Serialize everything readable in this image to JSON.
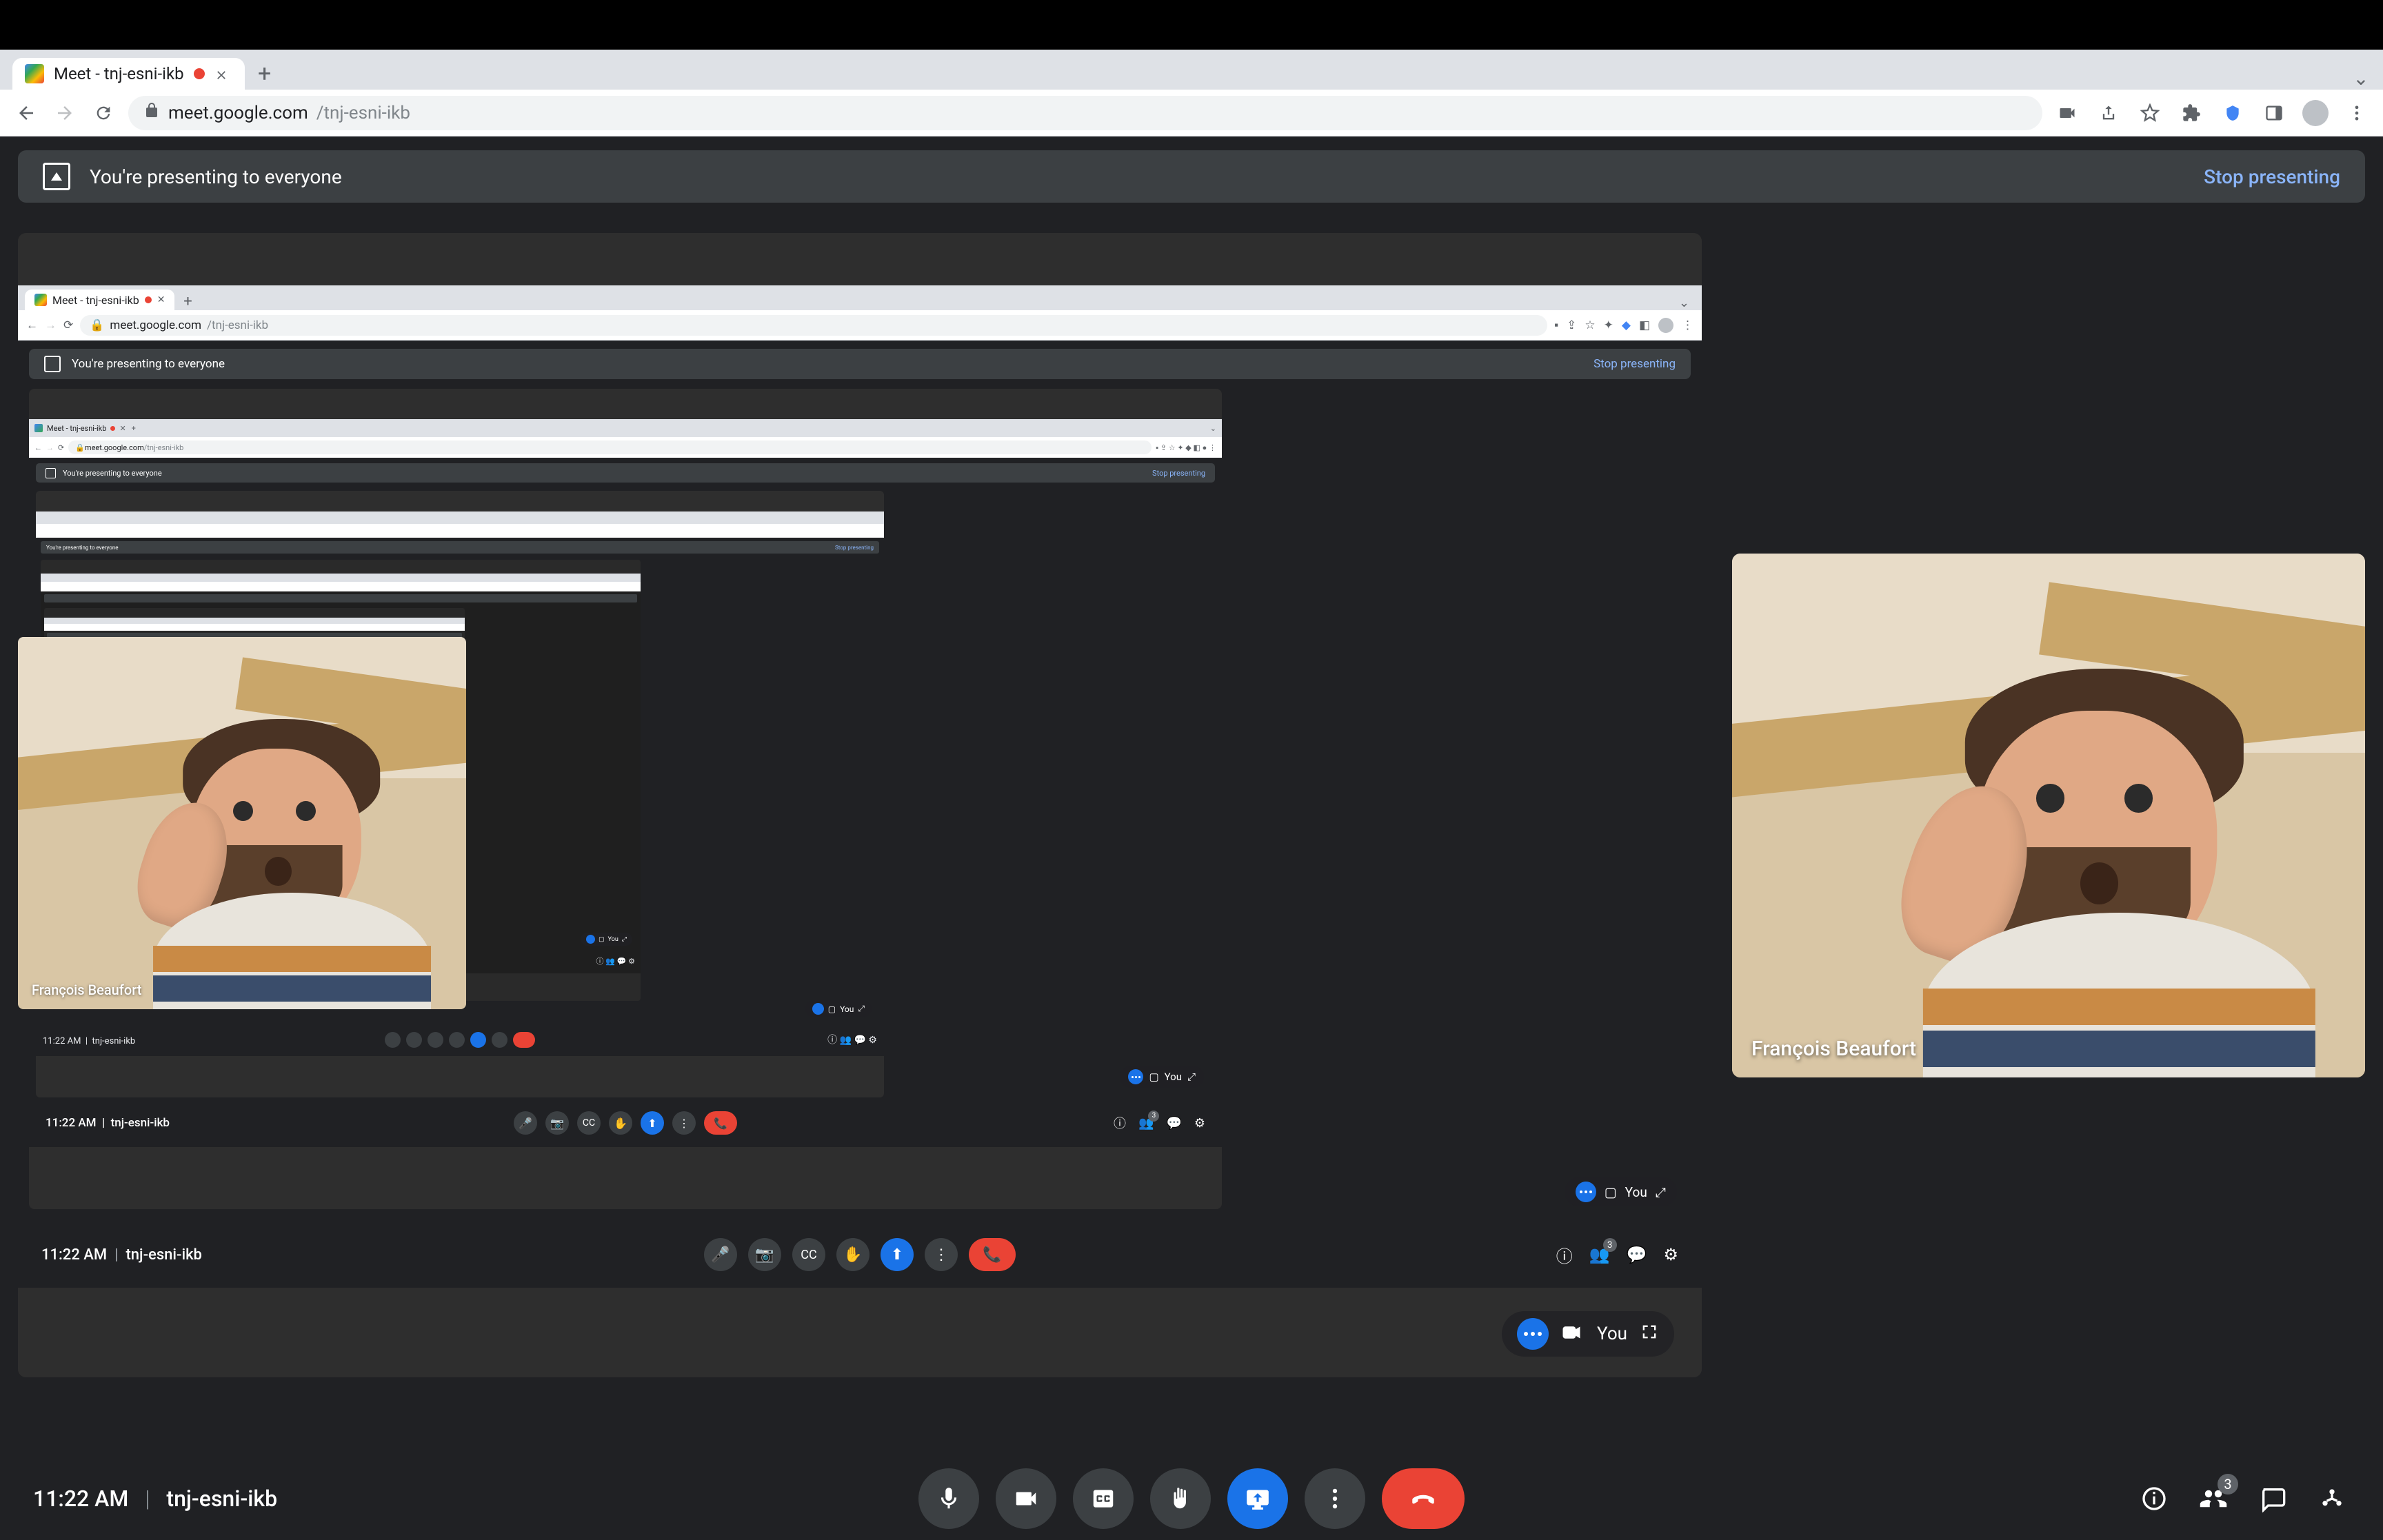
{
  "browser": {
    "tab_title": "Meet - tnj-esni-ikb",
    "url_host": "meet.google.com",
    "url_path": "/tnj-esni-ikb"
  },
  "banner": {
    "text": "You're presenting to everyone",
    "stop": "Stop presenting"
  },
  "participant": {
    "name": "François Beaufort"
  },
  "self_label": "You",
  "bottom": {
    "time": "11:22 AM",
    "code": "tnj-esni-ikb"
  },
  "badges": {
    "participants": "3"
  },
  "nested": {
    "tab_title": "Meet - tnj-esni-ikb",
    "url_host": "meet.google.com",
    "url_path": "/tnj-esni-ikb",
    "banner_text": "You're presenting to everyone",
    "banner_stop": "Stop presenting",
    "time": "11:22 AM",
    "code": "tnj-esni-ikb",
    "participant_name": "François Beaufort",
    "self_label": "You",
    "participants_badge": "3"
  }
}
